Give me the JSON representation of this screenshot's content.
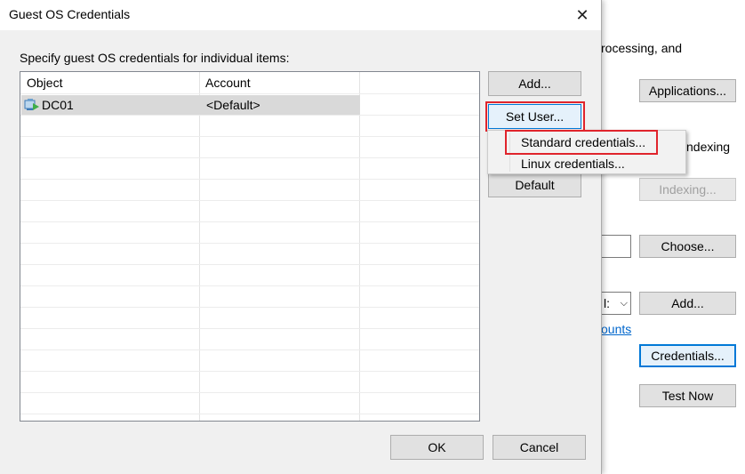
{
  "dialog": {
    "title": "Guest OS Credentials",
    "close_glyph": "✕",
    "instruction": "Specify guest OS credentials for individual items:",
    "table": {
      "columns": [
        "Object",
        "Account"
      ],
      "rows": [
        {
          "object": "DC01",
          "account": "<Default>",
          "icon": "vm-icon"
        }
      ]
    },
    "buttons": {
      "add": "Add...",
      "set_user": "Set User...",
      "default": "Default",
      "ok": "OK",
      "cancel": "Cancel"
    },
    "context_menu": {
      "items": [
        "Standard credentials...",
        "Linux credentials..."
      ]
    }
  },
  "background": {
    "text_processing": "rocessing, and",
    "text_indexing": "ndexing",
    "buttons": {
      "applications": "Applications...",
      "indexing": "Indexing...",
      "choose": "Choose...",
      "add": "Add...",
      "credentials": "Credentials...",
      "test_now": "Test Now"
    },
    "dropdown_fragment": "l:",
    "link_fragment": "ounts"
  },
  "colors": {
    "highlight": "#e0242c",
    "focus": "#0078d7",
    "link": "#0066cc"
  }
}
